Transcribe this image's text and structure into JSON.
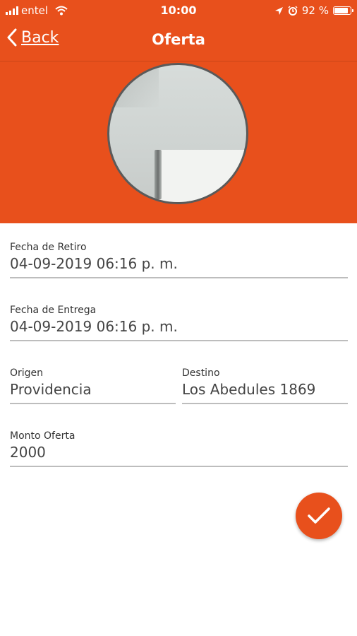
{
  "status_bar": {
    "carrier": "entel",
    "time": "10:00",
    "battery": "92 %",
    "icons": [
      "signal-icon",
      "wifi-icon",
      "location-arrow-icon",
      "alarm-icon",
      "battery-icon"
    ]
  },
  "header": {
    "back_label": "Back",
    "title": "Oferta"
  },
  "form": {
    "fecha_retiro": {
      "label": "Fecha de Retiro",
      "value": "04-09-2019 06:16 p. m."
    },
    "fecha_entrega": {
      "label": "Fecha de Entrega",
      "value": "04-09-2019 06:16 p. m."
    },
    "origen": {
      "label": "Origen",
      "value": "Providencia"
    },
    "destino": {
      "label": "Destino",
      "value": "Los Abedules 1869"
    },
    "monto": {
      "label": "Monto Oferta",
      "value": "2000"
    }
  },
  "colors": {
    "accent": "#e8501c",
    "underline": "#bdbdbd"
  }
}
